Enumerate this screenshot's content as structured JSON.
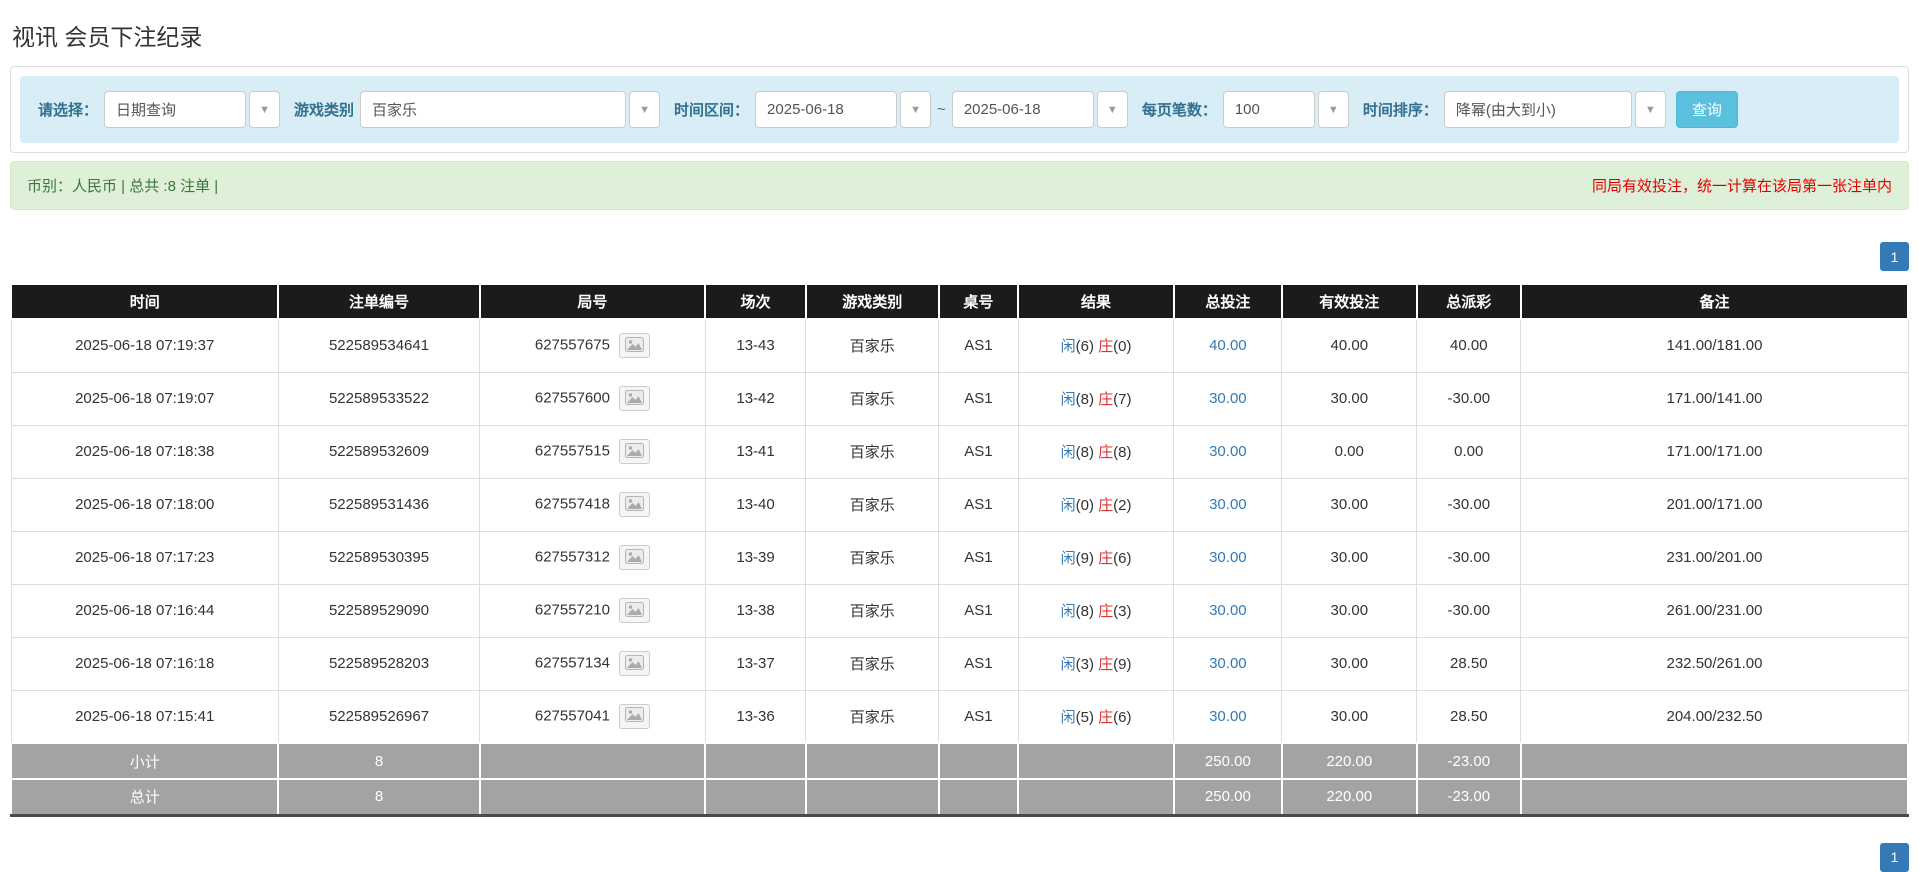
{
  "page": {
    "title": "视讯 会员下注纪录"
  },
  "filters": {
    "select_label": "请选择：",
    "select_value": "日期查询",
    "game_label": "游戏类别",
    "game_value": "百家乐",
    "range_label": "时间区间：",
    "date_from": "2025-06-18",
    "range_separator": "~",
    "date_to": "2025-06-18",
    "page_size_label": "每页笔数：",
    "page_size_value": "100",
    "sort_label": "时间排序：",
    "sort_value": "降幂(由大到小)",
    "query_button": "查询",
    "dropdown_arrow": "▼"
  },
  "summary_bar": {
    "left": "币别：人民币 | 总共 :8 注单 |",
    "right": "同局有效投注，统一计算在该局第一张注单内"
  },
  "pagination": {
    "page": "1"
  },
  "table": {
    "headers": [
      "时间",
      "注单编号",
      "局号",
      "场次",
      "游戏类别",
      "桌号",
      "结果",
      "总投注",
      "有效投注",
      "总派彩",
      "备注"
    ],
    "result_labels": {
      "player": "闲",
      "banker": "庄"
    },
    "rows": [
      {
        "time": "2025-06-18 07:19:37",
        "bet_no": "522589534641",
        "round_no": "627557675",
        "session": "13-43",
        "game": "百家乐",
        "table_no": "AS1",
        "player": "6",
        "banker": "0",
        "total_bet": "40.00",
        "valid_bet": "40.00",
        "payout": "40.00",
        "remark": "141.00/181.00"
      },
      {
        "time": "2025-06-18 07:19:07",
        "bet_no": "522589533522",
        "round_no": "627557600",
        "session": "13-42",
        "game": "百家乐",
        "table_no": "AS1",
        "player": "8",
        "banker": "7",
        "total_bet": "30.00",
        "valid_bet": "30.00",
        "payout": "-30.00",
        "remark": "171.00/141.00"
      },
      {
        "time": "2025-06-18 07:18:38",
        "bet_no": "522589532609",
        "round_no": "627557515",
        "session": "13-41",
        "game": "百家乐",
        "table_no": "AS1",
        "player": "8",
        "banker": "8",
        "total_bet": "30.00",
        "valid_bet": "0.00",
        "payout": "0.00",
        "remark": "171.00/171.00"
      },
      {
        "time": "2025-06-18 07:18:00",
        "bet_no": "522589531436",
        "round_no": "627557418",
        "session": "13-40",
        "game": "百家乐",
        "table_no": "AS1",
        "player": "0",
        "banker": "2",
        "total_bet": "30.00",
        "valid_bet": "30.00",
        "payout": "-30.00",
        "remark": "201.00/171.00"
      },
      {
        "time": "2025-06-18 07:17:23",
        "bet_no": "522589530395",
        "round_no": "627557312",
        "session": "13-39",
        "game": "百家乐",
        "table_no": "AS1",
        "player": "9",
        "banker": "6",
        "total_bet": "30.00",
        "valid_bet": "30.00",
        "payout": "-30.00",
        "remark": "231.00/201.00"
      },
      {
        "time": "2025-06-18 07:16:44",
        "bet_no": "522589529090",
        "round_no": "627557210",
        "session": "13-38",
        "game": "百家乐",
        "table_no": "AS1",
        "player": "8",
        "banker": "3",
        "total_bet": "30.00",
        "valid_bet": "30.00",
        "payout": "-30.00",
        "remark": "261.00/231.00"
      },
      {
        "time": "2025-06-18 07:16:18",
        "bet_no": "522589528203",
        "round_no": "627557134",
        "session": "13-37",
        "game": "百家乐",
        "table_no": "AS1",
        "player": "3",
        "banker": "9",
        "total_bet": "30.00",
        "valid_bet": "30.00",
        "payout": "28.50",
        "remark": "232.50/261.00"
      },
      {
        "time": "2025-06-18 07:15:41",
        "bet_no": "522589526967",
        "round_no": "627557041",
        "session": "13-36",
        "game": "百家乐",
        "table_no": "AS1",
        "player": "5",
        "banker": "6",
        "total_bet": "30.00",
        "valid_bet": "30.00",
        "payout": "28.50",
        "remark": "204.00/232.50"
      }
    ],
    "footer": [
      {
        "label": "小计",
        "count": "8",
        "total_bet": "250.00",
        "valid_bet": "220.00",
        "payout": "-23.00"
      },
      {
        "label": "总计",
        "count": "8",
        "total_bet": "250.00",
        "valid_bet": "220.00",
        "payout": "-23.00"
      }
    ]
  },
  "colors": {
    "accent_blue": "#337ab7",
    "banker_red": "#e03131",
    "negative_red": "#e03131",
    "query_button_bg": "#5bc0de",
    "filter_bar_bg": "#d9edf7",
    "summary_bar_bg": "#dff0d8",
    "header_bg": "#1b1b1b",
    "footer_bg": "#a3a3a3"
  }
}
